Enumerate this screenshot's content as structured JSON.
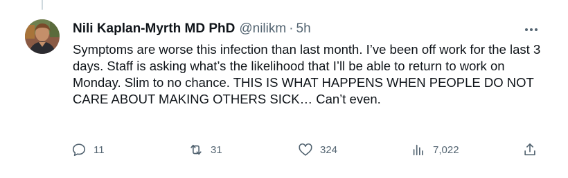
{
  "tweet": {
    "author": {
      "display_name": "Nili Kaplan-Myrth MD PhD",
      "handle": "@nilikm",
      "avatar_icon": "profile-photo"
    },
    "separator": "·",
    "time_ago": "5h",
    "text": "Symptoms are worse this infection than last month. I’ve been off work for the last 3 days. Staff is asking what’s the likelihood that I’ll be able to return to work on Monday. Slim to no chance. THIS IS WHAT HAPPENS WHEN PEOPLE DO NOT CARE ABOUT MAKING OTHERS SICK… Can’t even.",
    "more_icon": "more-horizontal-icon"
  },
  "actions": {
    "reply": {
      "icon": "reply-icon",
      "count": "11"
    },
    "retweet": {
      "icon": "retweet-icon",
      "count": "31"
    },
    "like": {
      "icon": "heart-icon",
      "count": "324"
    },
    "views": {
      "icon": "views-icon",
      "count": "7,022"
    },
    "share": {
      "icon": "share-icon"
    }
  },
  "colors": {
    "text_primary": "#0f1419",
    "text_secondary": "#536471",
    "thread_line": "#cfd9de",
    "background": "#ffffff"
  }
}
